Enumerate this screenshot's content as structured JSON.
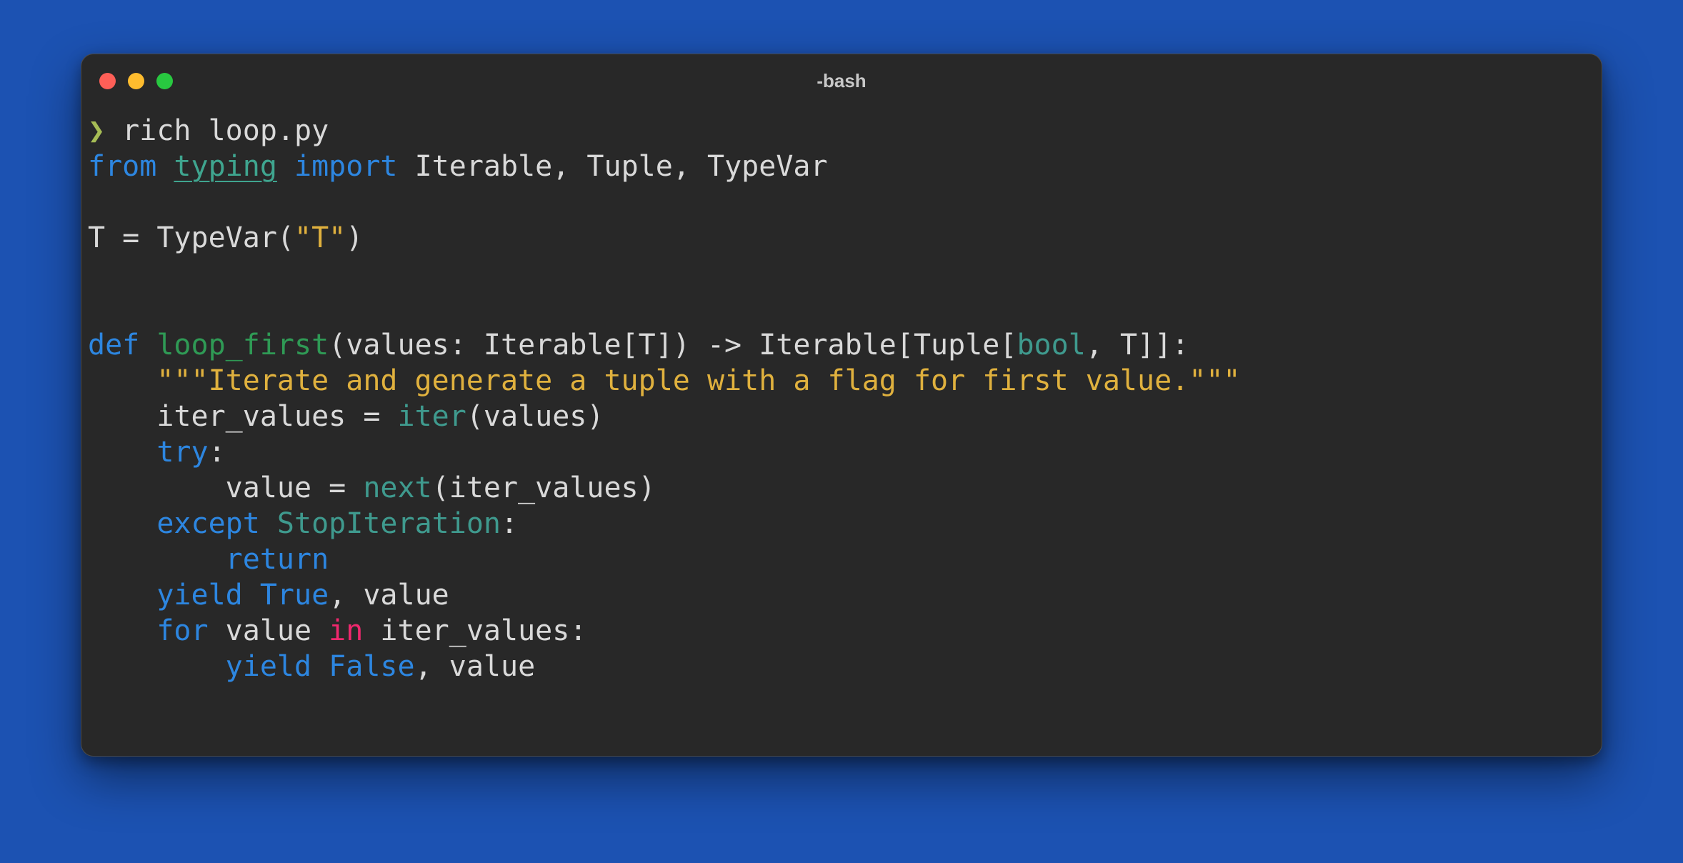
{
  "window": {
    "title": "-bash"
  },
  "colors": {
    "desktop_background": "#1c52b2",
    "terminal_background": "#282828",
    "keyword": "#2d86e0",
    "function_name": "#2f9a55",
    "builtin": "#3f9a8e",
    "string": "#e0b13e",
    "operator_in": "#f0286e",
    "prompt_symbol": "#a6bc55",
    "text": "#d9d9d9"
  },
  "terminal": {
    "prompt": {
      "symbol": "❯",
      "command": " rich loop.py"
    },
    "code": {
      "l1": [
        "from",
        " ",
        "typing",
        " ",
        "import",
        " Iterable, Tuple, TypeVar"
      ],
      "l3": [
        "T = TypeVar(",
        "\"T\"",
        ")"
      ],
      "l6": [
        "def",
        " ",
        "loop_first",
        "(values: Iterable[T]) -> Iterable[Tuple[",
        "bool",
        ", T]]:"
      ],
      "l7": [
        "    ",
        "\"\"\"Iterate and generate a tuple with a flag for first value.\"\"\""
      ],
      "l8": [
        "    iter_values = ",
        "iter",
        "(values)"
      ],
      "l9": [
        "    ",
        "try",
        ":"
      ],
      "l10": [
        "        value = ",
        "next",
        "(iter_values)"
      ],
      "l11": [
        "    ",
        "except",
        " ",
        "StopIteration",
        ":"
      ],
      "l12": [
        "        ",
        "return"
      ],
      "l13": [
        "    ",
        "yield",
        " ",
        "True",
        ", value"
      ],
      "l14": [
        "    ",
        "for",
        " value ",
        "in",
        " iter_values:"
      ],
      "l15": [
        "        ",
        "yield",
        " ",
        "False",
        ", value"
      ]
    }
  }
}
